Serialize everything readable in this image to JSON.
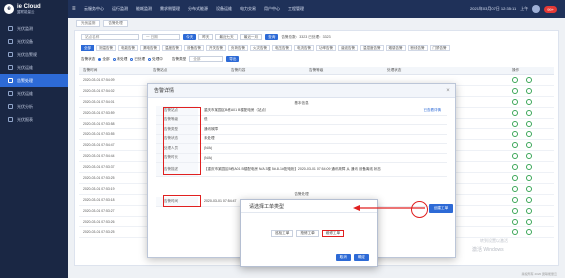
{
  "brand": {
    "logo_mark": "e",
    "name": "ie Cloud",
    "subtitle": "翼联能量云"
  },
  "topbar": {
    "items": [
      "云服务中心",
      "运行监测",
      "能耗监测",
      "需求侧管理",
      "分布式能源",
      "设备运维",
      "电力交易",
      "用户中心",
      "工程管理"
    ],
    "datetime": "2021年03月07日 12:35:11",
    "user": "上午",
    "alert_badge": "99+"
  },
  "sidebar": {
    "items": [
      {
        "label": "光伏监测",
        "active": false
      },
      {
        "label": "光伏设备",
        "active": false
      },
      {
        "label": "光伏告警规",
        "active": false
      },
      {
        "label": "光伏运维",
        "active": false
      },
      {
        "label": "告警处理",
        "active": true
      },
      {
        "label": "光伏运维",
        "active": false
      },
      {
        "label": "光伏分析",
        "active": false
      },
      {
        "label": "光伏报表",
        "active": false
      }
    ]
  },
  "breadcrumb": {
    "home": "光伏监测",
    "current": "告警处理"
  },
  "filters": {
    "search_placeholder": "站点名称",
    "date_placeholder": "一 日期",
    "range_buttons": [
      "今天",
      "昨天",
      "最近七天",
      "最近一月"
    ],
    "query_label": "查询",
    "summary": "告警总数：3323  已处理：3323"
  },
  "categories": [
    "全部",
    "测温告警",
    "电能告警",
    "漏电告警",
    "温度告警",
    "设备告警",
    "开关告警",
    "负荷告警",
    "火灾告警",
    "电压告警",
    "电流告警",
    "功率告警",
    "谐波告警",
    "温湿度告警",
    "烟感告警",
    "断线告警",
    "门禁告警"
  ],
  "status_row": {
    "label": "告警状态",
    "options": [
      "全部",
      "未处理",
      "已处理",
      "处理中"
    ],
    "type_label": "告警类型",
    "type_value": "全部",
    "export_label": "导出"
  },
  "table": {
    "headers": [
      "告警时间",
      "告警站点",
      "告警内容",
      "告警等级",
      "处理状态",
      "操作"
    ],
    "rows": [
      {
        "time": "2020-03-01 07:54:09"
      },
      {
        "time": "2020-03-01 07:54:02"
      },
      {
        "time": "2020-03-01 07:54:01"
      },
      {
        "time": "2020-03-01 07:53:59"
      },
      {
        "time": "2020-03-01 07:53:58"
      },
      {
        "time": "2020-03-01 07:53:55"
      },
      {
        "time": "2020-03-01 07:54:47"
      },
      {
        "time": "2020-03-01 07:54:44"
      },
      {
        "time": "2020-03-01 07:53:37"
      },
      {
        "time": "2020-03-01 07:53:25"
      },
      {
        "time": "2020-03-01 07:53:19"
      },
      {
        "time": "2020-03-01 07:53:18"
      },
      {
        "time": "2020-03-01 07:53:27"
      },
      {
        "time": "2020-03-01 07:53:26"
      },
      {
        "time": "2020-03-01 07:53:25"
      }
    ]
  },
  "detail_dialog": {
    "title": "告警详情",
    "section_basic": "基本信息",
    "fields": [
      {
        "key": "告警站点",
        "value": "重庆市某园区B栋A01 B楼配电房（站点）",
        "link": "已查看详情"
      },
      {
        "key": "告警等级",
        "value": "低"
      },
      {
        "key": "告警类型",
        "value": "通讯故障"
      },
      {
        "key": "告警状态",
        "value": "未处理"
      },
      {
        "key": "处理人员",
        "value": "(N/A)"
      },
      {
        "key": "告警时长",
        "value": "(N/A)"
      },
      {
        "key": "告警描述",
        "value": "【重庆市某园区B栋A01 B楼配电房 N/A 3楼 5#-8-1#配电柜】2020-03-01 07:54:09 通讯故障 从 通讯 设备离线 状态"
      }
    ],
    "section_process": "告警处理",
    "bottom_field": {
      "key": "告警时间",
      "value": "2020-03-01 07:54:47"
    }
  },
  "work_order_dialog": {
    "title": "请选择工单类型",
    "options": [
      "巡检工单",
      "抢修工单",
      "维修工单"
    ],
    "confirm": "取消",
    "cancel": "确定"
  },
  "actions": {
    "create_work_order": "创建工单"
  },
  "watermark": {
    "line1": "激活 Windows",
    "line2": "转到设置以激活"
  },
  "footer": "版权所有 2020 翼联能量云"
}
